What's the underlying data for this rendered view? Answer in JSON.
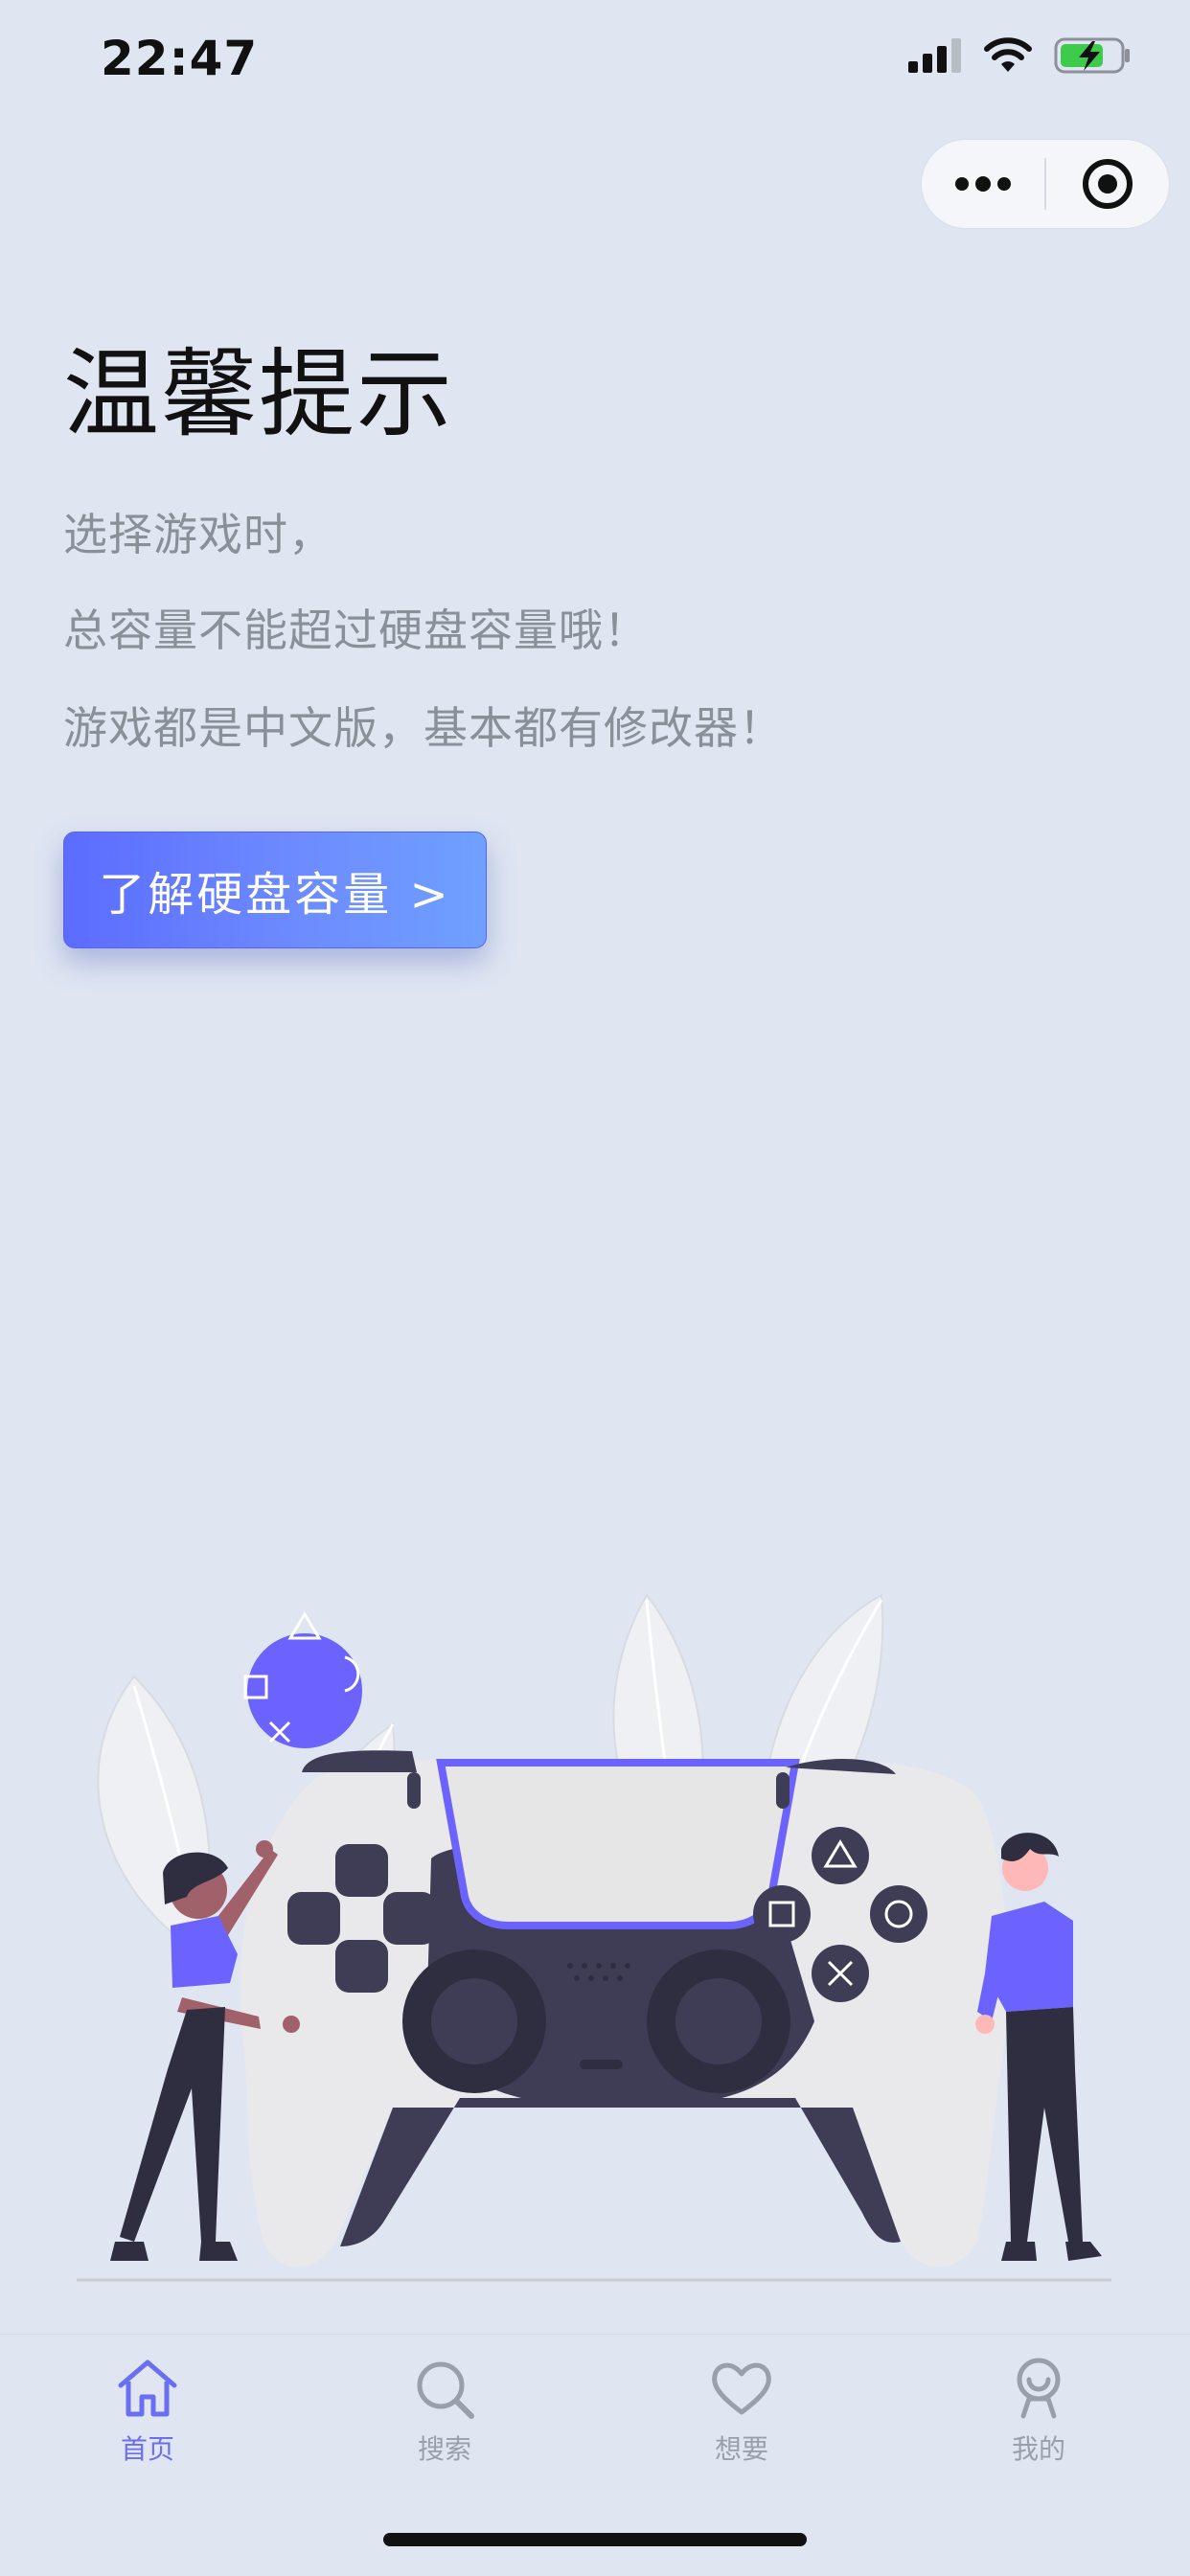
{
  "status_bar": {
    "time": "22:47"
  },
  "capsule": {
    "more_icon": "more-dots-icon",
    "close_icon": "target-circle-icon"
  },
  "header": {
    "title": "温馨提示"
  },
  "tips": [
    "选择游戏时，",
    "总容量不能超过硬盘容量哦！",
    "游戏都是中文版，基本都有修改器！"
  ],
  "cta": {
    "label": "了解硬盘容量 >"
  },
  "tabbar": {
    "tabs": [
      {
        "label": "首页",
        "icon": "home-icon",
        "active": true
      },
      {
        "label": "搜索",
        "icon": "search-icon",
        "active": false
      },
      {
        "label": "想要",
        "icon": "heart-icon",
        "active": false
      },
      {
        "label": "我的",
        "icon": "profile-icon",
        "active": false
      }
    ]
  },
  "colors": {
    "background": "#dfe6f2",
    "accent": "#6a6ff2",
    "button_start": "#5b6cff",
    "button_end": "#6fa0ff"
  }
}
